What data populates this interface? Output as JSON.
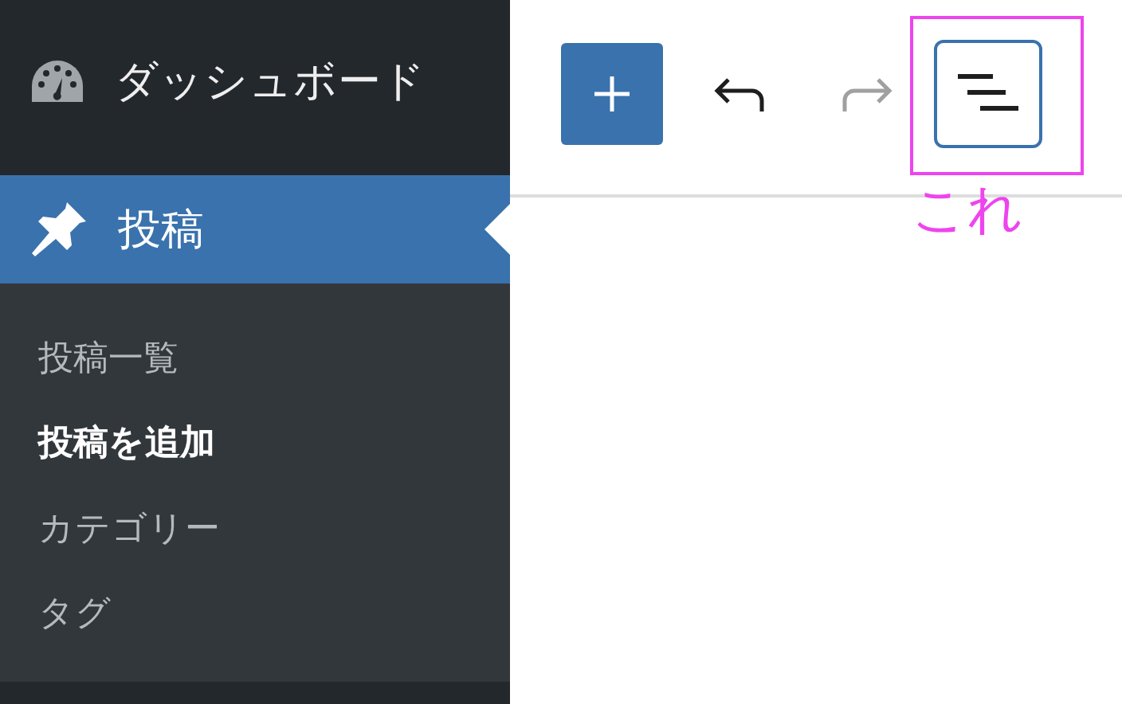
{
  "sidebar": {
    "items": [
      {
        "label": "ダッシュボード",
        "selected": false
      },
      {
        "label": "投稿",
        "selected": true,
        "children": [
          {
            "label": "投稿一覧",
            "selected": false
          },
          {
            "label": "投稿を追加",
            "selected": true
          },
          {
            "label": "カテゴリー",
            "selected": false
          },
          {
            "label": "タグ",
            "selected": false
          }
        ]
      }
    ]
  },
  "toolbar": {
    "buttons": [
      {
        "kind": "add",
        "disabled": false,
        "focused": false
      },
      {
        "kind": "undo",
        "disabled": false,
        "focused": false
      },
      {
        "kind": "redo",
        "disabled": true,
        "focused": false
      },
      {
        "kind": "outline",
        "disabled": false,
        "focused": true
      }
    ]
  },
  "annotation": {
    "label": "これ"
  }
}
